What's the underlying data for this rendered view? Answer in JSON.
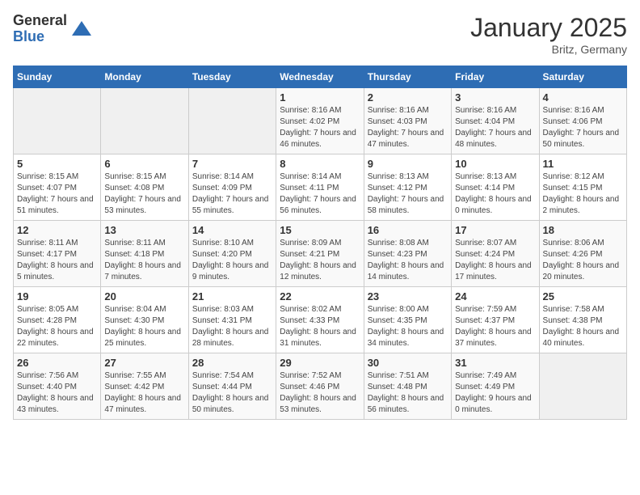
{
  "logo": {
    "general": "General",
    "blue": "Blue"
  },
  "title": "January 2025",
  "subtitle": "Britz, Germany",
  "days_of_week": [
    "Sunday",
    "Monday",
    "Tuesday",
    "Wednesday",
    "Thursday",
    "Friday",
    "Saturday"
  ],
  "weeks": [
    [
      {
        "day": "",
        "info": ""
      },
      {
        "day": "",
        "info": ""
      },
      {
        "day": "",
        "info": ""
      },
      {
        "day": "1",
        "info": "Sunrise: 8:16 AM\nSunset: 4:02 PM\nDaylight: 7 hours and 46 minutes."
      },
      {
        "day": "2",
        "info": "Sunrise: 8:16 AM\nSunset: 4:03 PM\nDaylight: 7 hours and 47 minutes."
      },
      {
        "day": "3",
        "info": "Sunrise: 8:16 AM\nSunset: 4:04 PM\nDaylight: 7 hours and 48 minutes."
      },
      {
        "day": "4",
        "info": "Sunrise: 8:16 AM\nSunset: 4:06 PM\nDaylight: 7 hours and 50 minutes."
      }
    ],
    [
      {
        "day": "5",
        "info": "Sunrise: 8:15 AM\nSunset: 4:07 PM\nDaylight: 7 hours and 51 minutes."
      },
      {
        "day": "6",
        "info": "Sunrise: 8:15 AM\nSunset: 4:08 PM\nDaylight: 7 hours and 53 minutes."
      },
      {
        "day": "7",
        "info": "Sunrise: 8:14 AM\nSunset: 4:09 PM\nDaylight: 7 hours and 55 minutes."
      },
      {
        "day": "8",
        "info": "Sunrise: 8:14 AM\nSunset: 4:11 PM\nDaylight: 7 hours and 56 minutes."
      },
      {
        "day": "9",
        "info": "Sunrise: 8:13 AM\nSunset: 4:12 PM\nDaylight: 7 hours and 58 minutes."
      },
      {
        "day": "10",
        "info": "Sunrise: 8:13 AM\nSunset: 4:14 PM\nDaylight: 8 hours and 0 minutes."
      },
      {
        "day": "11",
        "info": "Sunrise: 8:12 AM\nSunset: 4:15 PM\nDaylight: 8 hours and 2 minutes."
      }
    ],
    [
      {
        "day": "12",
        "info": "Sunrise: 8:11 AM\nSunset: 4:17 PM\nDaylight: 8 hours and 5 minutes."
      },
      {
        "day": "13",
        "info": "Sunrise: 8:11 AM\nSunset: 4:18 PM\nDaylight: 8 hours and 7 minutes."
      },
      {
        "day": "14",
        "info": "Sunrise: 8:10 AM\nSunset: 4:20 PM\nDaylight: 8 hours and 9 minutes."
      },
      {
        "day": "15",
        "info": "Sunrise: 8:09 AM\nSunset: 4:21 PM\nDaylight: 8 hours and 12 minutes."
      },
      {
        "day": "16",
        "info": "Sunrise: 8:08 AM\nSunset: 4:23 PM\nDaylight: 8 hours and 14 minutes."
      },
      {
        "day": "17",
        "info": "Sunrise: 8:07 AM\nSunset: 4:24 PM\nDaylight: 8 hours and 17 minutes."
      },
      {
        "day": "18",
        "info": "Sunrise: 8:06 AM\nSunset: 4:26 PM\nDaylight: 8 hours and 20 minutes."
      }
    ],
    [
      {
        "day": "19",
        "info": "Sunrise: 8:05 AM\nSunset: 4:28 PM\nDaylight: 8 hours and 22 minutes."
      },
      {
        "day": "20",
        "info": "Sunrise: 8:04 AM\nSunset: 4:30 PM\nDaylight: 8 hours and 25 minutes."
      },
      {
        "day": "21",
        "info": "Sunrise: 8:03 AM\nSunset: 4:31 PM\nDaylight: 8 hours and 28 minutes."
      },
      {
        "day": "22",
        "info": "Sunrise: 8:02 AM\nSunset: 4:33 PM\nDaylight: 8 hours and 31 minutes."
      },
      {
        "day": "23",
        "info": "Sunrise: 8:00 AM\nSunset: 4:35 PM\nDaylight: 8 hours and 34 minutes."
      },
      {
        "day": "24",
        "info": "Sunrise: 7:59 AM\nSunset: 4:37 PM\nDaylight: 8 hours and 37 minutes."
      },
      {
        "day": "25",
        "info": "Sunrise: 7:58 AM\nSunset: 4:38 PM\nDaylight: 8 hours and 40 minutes."
      }
    ],
    [
      {
        "day": "26",
        "info": "Sunrise: 7:56 AM\nSunset: 4:40 PM\nDaylight: 8 hours and 43 minutes."
      },
      {
        "day": "27",
        "info": "Sunrise: 7:55 AM\nSunset: 4:42 PM\nDaylight: 8 hours and 47 minutes."
      },
      {
        "day": "28",
        "info": "Sunrise: 7:54 AM\nSunset: 4:44 PM\nDaylight: 8 hours and 50 minutes."
      },
      {
        "day": "29",
        "info": "Sunrise: 7:52 AM\nSunset: 4:46 PM\nDaylight: 8 hours and 53 minutes."
      },
      {
        "day": "30",
        "info": "Sunrise: 7:51 AM\nSunset: 4:48 PM\nDaylight: 8 hours and 56 minutes."
      },
      {
        "day": "31",
        "info": "Sunrise: 7:49 AM\nSunset: 4:49 PM\nDaylight: 9 hours and 0 minutes."
      },
      {
        "day": "",
        "info": ""
      }
    ]
  ]
}
